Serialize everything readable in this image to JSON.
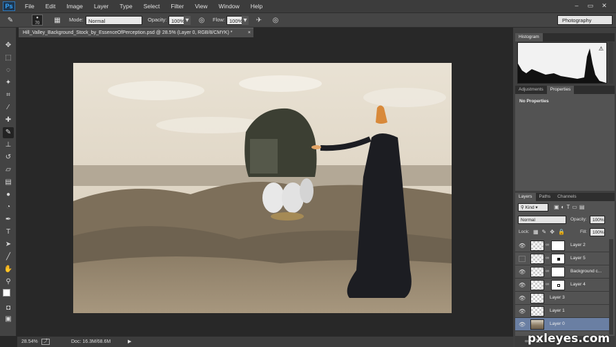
{
  "app": {
    "logo": "Ps"
  },
  "menu": [
    "File",
    "Edit",
    "Image",
    "Layer",
    "Type",
    "Select",
    "Filter",
    "View",
    "Window",
    "Help"
  ],
  "options": {
    "brush_size": "70",
    "mode_label": "Mode:",
    "mode_value": "Normal",
    "opacity_label": "Opacity:",
    "opacity_value": "100%",
    "flow_label": "Flow:",
    "flow_value": "100%"
  },
  "workspace": "Photography",
  "document": {
    "tab_title": "Hill_Valley_Background_Stock_by_EssenceOfPerception.psd @ 28.5% (Layer 0, RGB/8/CMYK) *",
    "close": "×"
  },
  "status": {
    "zoom": "28.54%",
    "doc": "Doc: 16.3M/68.6M"
  },
  "panels": {
    "histogram_tab": "Histogram",
    "adjustments_tab": "Adjustments",
    "properties_tab": "Properties",
    "properties_text": "No Properties",
    "layers_tab": "Layers",
    "paths_tab": "Paths",
    "channels_tab": "Channels"
  },
  "layers_panel": {
    "kind": "Kind",
    "blend": "Normal",
    "opacity_label": "Opacity:",
    "opacity_value": "100%",
    "lock_label": "Lock:",
    "fill_label": "Fill:",
    "fill_value": "100%"
  },
  "layers": [
    {
      "name": "Layer 2",
      "visible": true,
      "mask": true
    },
    {
      "name": "Layer 5",
      "visible": false,
      "mask": true
    },
    {
      "name": "Background c...",
      "visible": true,
      "mask": true
    },
    {
      "name": "Layer 4",
      "visible": true,
      "mask": true
    },
    {
      "name": "Layer 3",
      "visible": true,
      "mask": false
    },
    {
      "name": "Layer 1",
      "visible": true,
      "mask": false
    },
    {
      "name": "Layer 0",
      "visible": true,
      "mask": false,
      "selected": true
    }
  ],
  "watermark": "pxleyes.com"
}
